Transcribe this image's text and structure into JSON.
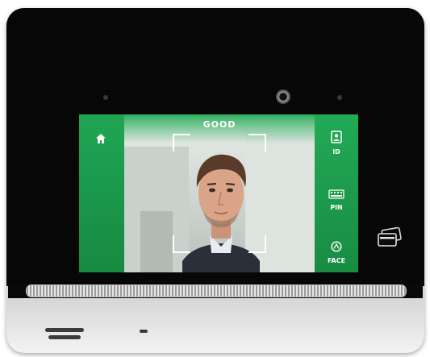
{
  "screen": {
    "status_text": "GOOD",
    "side_buttons": [
      {
        "label": "ID",
        "icon": "id-card-icon"
      },
      {
        "label": "PIN",
        "icon": "keypad-icon"
      },
      {
        "label": "FACE",
        "icon": "face-icon"
      }
    ],
    "home_icon": "home-icon"
  },
  "device": {
    "card_reader_icon": "card-reader-icon"
  },
  "colors": {
    "accent_green": "#1f9a4d",
    "bezel": "#070707",
    "frame": "#ffffff"
  }
}
